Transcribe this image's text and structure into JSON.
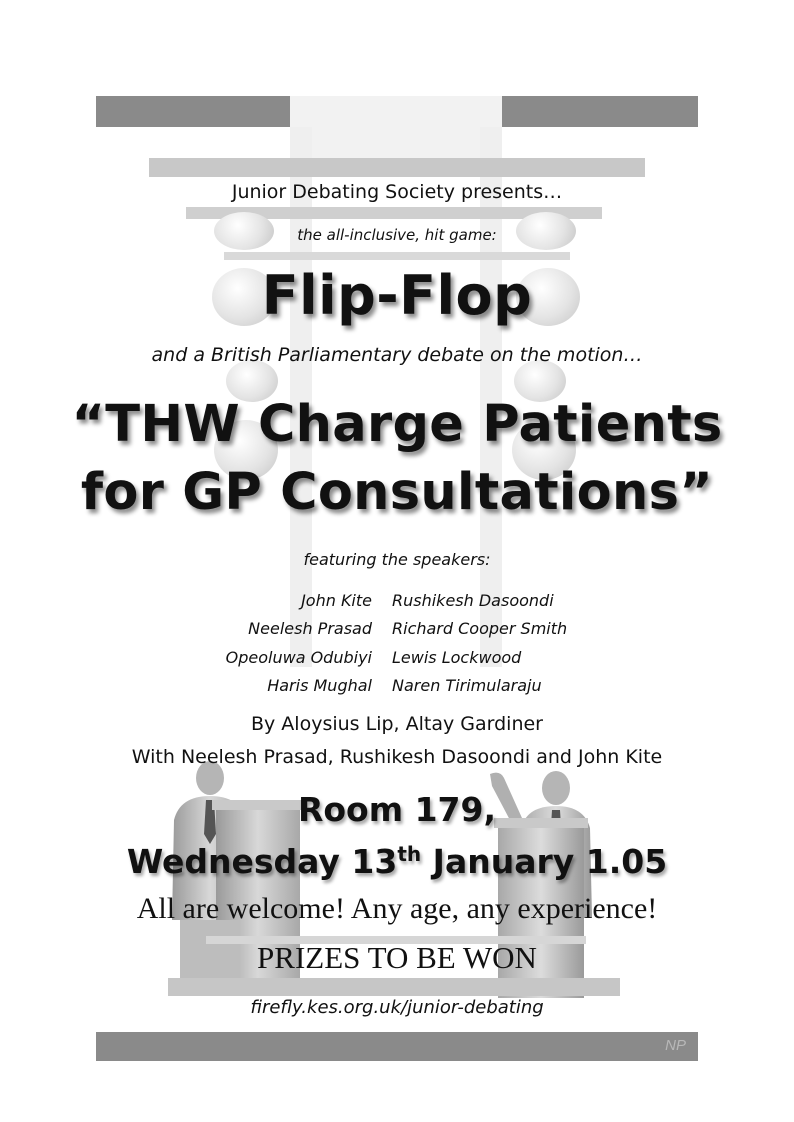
{
  "intro": {
    "presents": "Junior Debating Society presents…",
    "hit_game": "the all-inclusive, hit game:"
  },
  "game_title": "Flip-Flop",
  "motion": {
    "intro": "and a British Parliamentary debate on the motion…",
    "line1": "“THW Charge Patients",
    "line2": "for GP Consultations”"
  },
  "featuring_label": "featuring the speakers:",
  "speakers": [
    {
      "left": "John Kite",
      "right": "Rushikesh Dasoondi"
    },
    {
      "left": "Neelesh Prasad",
      "right": "Richard Cooper Smith"
    },
    {
      "left": "Opeoluwa Odubiyi",
      "right": "Lewis Lockwood"
    },
    {
      "left": "Haris Mughal",
      "right": "Naren Tirimularaju"
    }
  ],
  "credits": {
    "by": "By Aloysius Lip, Altay Gardiner",
    "with": "With Neelesh Prasad, Rushikesh Dasoondi and John Kite"
  },
  "event": {
    "room": "Room 179,",
    "date_prefix": "Wednesday 13",
    "date_sup": "th",
    "date_suffix": " January 1.05"
  },
  "welcome": "All are welcome! Any age, any experience!",
  "prizes": "PRIZES TO BE WON",
  "url": "firefly.kes.org.uk/junior-debating",
  "initials": "NP",
  "colors": {
    "dark_bar": "#8a8a8a",
    "light_bar": "#c8c8c8",
    "text": "#111111"
  }
}
